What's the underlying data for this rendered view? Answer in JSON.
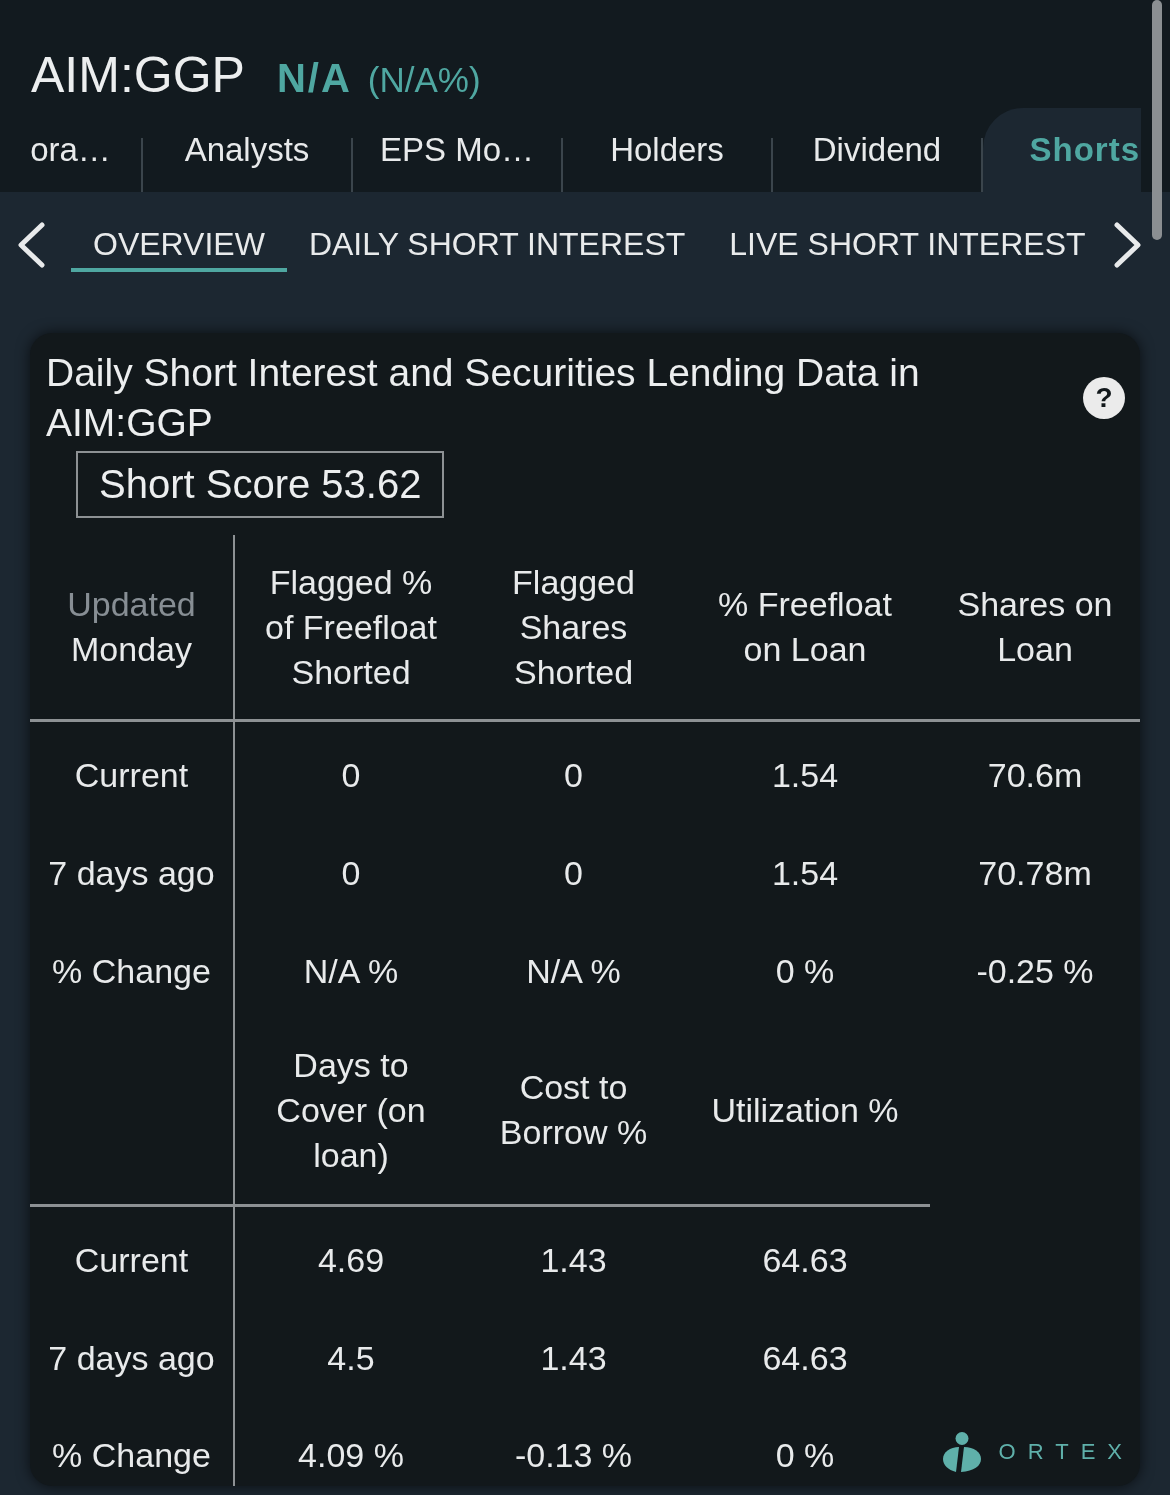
{
  "header": {
    "symbol": "AIM:GGP",
    "price": "N/A",
    "change": "(N/A%)"
  },
  "tabs": [
    {
      "label": "ora…",
      "selected": false
    },
    {
      "label": "Analysts",
      "selected": false
    },
    {
      "label": "EPS Mo…",
      "selected": false
    },
    {
      "label": "Holders",
      "selected": false
    },
    {
      "label": "Dividend",
      "selected": false
    },
    {
      "label": "Shorts",
      "selected": true
    }
  ],
  "subtabs": [
    {
      "label": "OVERVIEW",
      "selected": true
    },
    {
      "label": "DAILY SHORT INTEREST",
      "selected": false
    },
    {
      "label": "LIVE SHORT INTEREST",
      "selected": false
    }
  ],
  "card": {
    "title": "Daily Short Interest and Securities Lending Data in AIM:GGP",
    "help": "?",
    "short_score": "Short Score 53.62",
    "sections": [
      {
        "corner": {
          "label": "Updated",
          "value": "Monday"
        },
        "columns": [
          "Flagged % of Freefloat Shorted",
          "Flagged Shares Shorted",
          "% Freefloat on Loan",
          "Shares on Loan"
        ],
        "rows": [
          {
            "label": "Current",
            "cells": [
              "0",
              "0",
              "1.54",
              "70.6m"
            ]
          },
          {
            "label": "7 days ago",
            "cells": [
              "0",
              "0",
              "1.54",
              "70.78m"
            ]
          },
          {
            "label": "% Change",
            "cells": [
              "N/A %",
              "N/A %",
              "0 %",
              "-0.25 %"
            ]
          }
        ]
      },
      {
        "columns": [
          "Days to Cover (on loan)",
          "Cost to Borrow %",
          "Utilization %"
        ],
        "rows": [
          {
            "label": "Current",
            "cells": [
              "4.69",
              "1.43",
              "64.63"
            ]
          },
          {
            "label": "7 days ago",
            "cells": [
              "4.5",
              "1.43",
              "64.63"
            ]
          },
          {
            "label": "% Change",
            "cells": [
              "4.09 %",
              "-0.13 %",
              "0 %"
            ]
          }
        ]
      }
    ],
    "logo": "ORTEX"
  }
}
